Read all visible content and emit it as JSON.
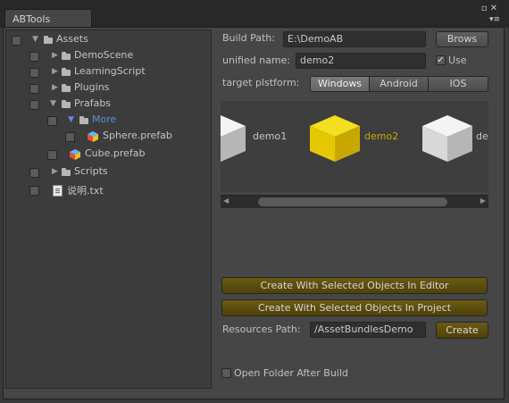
{
  "window": {
    "tab_title": "ABTools",
    "controls": "▫✕",
    "menu": "▾≡"
  },
  "tree": {
    "items": [
      {
        "label": "Assets",
        "kind": "folder"
      },
      {
        "label": "DemoScene",
        "kind": "folder"
      },
      {
        "label": "LearningScript",
        "kind": "folder"
      },
      {
        "label": "Plugins",
        "kind": "folder"
      },
      {
        "label": "Prafabs",
        "kind": "folder"
      },
      {
        "label": "More",
        "kind": "folder"
      },
      {
        "label": "Sphere.prefab",
        "kind": "prefab"
      },
      {
        "label": "Cube.prefab",
        "kind": "prefab"
      },
      {
        "label": "Scripts",
        "kind": "folder"
      },
      {
        "label": "说明.txt",
        "kind": "text"
      }
    ]
  },
  "build": {
    "path_label": "Build Path:",
    "path_value": "E:\\DemoAB",
    "browse_label": "Brows",
    "name_label": "unified name:",
    "name_value": "demo2",
    "use_label": "Use",
    "use_checked": true,
    "platform_label": "target plstform:",
    "platforms": [
      "Windows",
      "Android",
      "IOS"
    ],
    "selected_platform": "Windows"
  },
  "preview": {
    "items": [
      {
        "label": "demo1",
        "color": "#e6e6e6",
        "selected": false
      },
      {
        "label": "demo2",
        "color": "#e6c800",
        "selected": true
      },
      {
        "label": "de",
        "color": "#e6e6e6",
        "selected": false
      }
    ],
    "selected_label_color": "#c8a800"
  },
  "actions": {
    "editor_label": "Create With Selected Objects In Editor",
    "project_label": "Create With Selected Objects In Project",
    "resources_label": "Resources Path:",
    "resources_value": "/AssetBundlesDemo",
    "create_label": "Create",
    "open_folder_label": "Open Folder After Build",
    "open_folder_checked": false
  }
}
